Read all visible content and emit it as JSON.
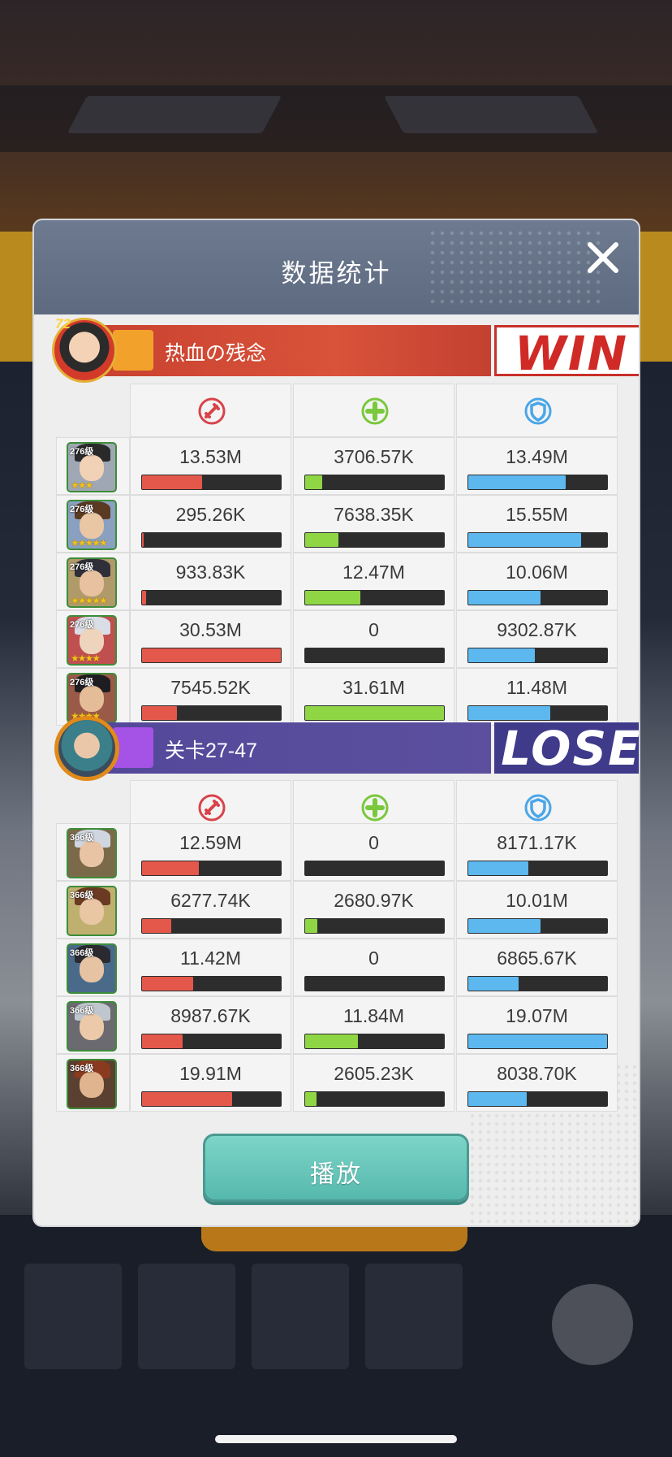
{
  "modal": {
    "title": "数据统计",
    "play_label": "播放"
  },
  "win_team": {
    "avatar_level": "72",
    "name": "热血の残念",
    "result": "WIN",
    "heroes": [
      {
        "level": "276级",
        "stars": "★★★",
        "damage": "13.53M",
        "damage_ratio": 0.43,
        "heal": "3706.57K",
        "heal_ratio": 0.12,
        "defense": "13.49M",
        "defense_ratio": 0.7
      },
      {
        "level": "276级",
        "stars": "★★★★★",
        "damage": "295.26K",
        "damage_ratio": 0.01,
        "heal": "7638.35K",
        "heal_ratio": 0.24,
        "defense": "15.55M",
        "defense_ratio": 0.81
      },
      {
        "level": "276级",
        "stars": "★★★★★",
        "damage": "933.83K",
        "damage_ratio": 0.03,
        "heal": "12.47M",
        "heal_ratio": 0.4,
        "defense": "10.06M",
        "defense_ratio": 0.52
      },
      {
        "level": "276级",
        "stars": "★★★★",
        "damage": "30.53M",
        "damage_ratio": 1.0,
        "heal": "0",
        "heal_ratio": 0.0,
        "defense": "9302.87K",
        "defense_ratio": 0.48
      },
      {
        "level": "276级",
        "stars": "★★★★",
        "damage": "7545.52K",
        "damage_ratio": 0.25,
        "heal": "31.61M",
        "heal_ratio": 1.0,
        "defense": "11.48M",
        "defense_ratio": 0.59
      }
    ]
  },
  "lose_team": {
    "name": "关卡27-47",
    "result": "LOSE",
    "heroes": [
      {
        "level": "366级",
        "damage": "12.59M",
        "damage_ratio": 0.41,
        "heal": "0",
        "heal_ratio": 0.0,
        "defense": "8171.17K",
        "defense_ratio": 0.43
      },
      {
        "level": "366级",
        "damage": "6277.74K",
        "damage_ratio": 0.21,
        "heal": "2680.97K",
        "heal_ratio": 0.09,
        "defense": "10.01M",
        "defense_ratio": 0.52
      },
      {
        "level": "366级",
        "damage": "11.42M",
        "damage_ratio": 0.37,
        "heal": "0",
        "heal_ratio": 0.0,
        "defense": "6865.67K",
        "defense_ratio": 0.36
      },
      {
        "level": "366级",
        "damage": "8987.67K",
        "damage_ratio": 0.29,
        "heal": "11.84M",
        "heal_ratio": 0.38,
        "defense": "19.07M",
        "defense_ratio": 1.0
      },
      {
        "level": "366级",
        "damage": "19.91M",
        "damage_ratio": 0.65,
        "heal": "2605.23K",
        "heal_ratio": 0.08,
        "defense": "8038.70K",
        "defense_ratio": 0.42
      }
    ]
  },
  "stat_icons": [
    "sword-icon",
    "heal-cross-icon",
    "shield-icon"
  ],
  "colors": {
    "damage": "#e4584c",
    "heal": "#8fd645",
    "defense": "#5db8ef",
    "win": "#d02a26",
    "lose": "#3f3a8a",
    "play_button": "#6cc7bb"
  }
}
